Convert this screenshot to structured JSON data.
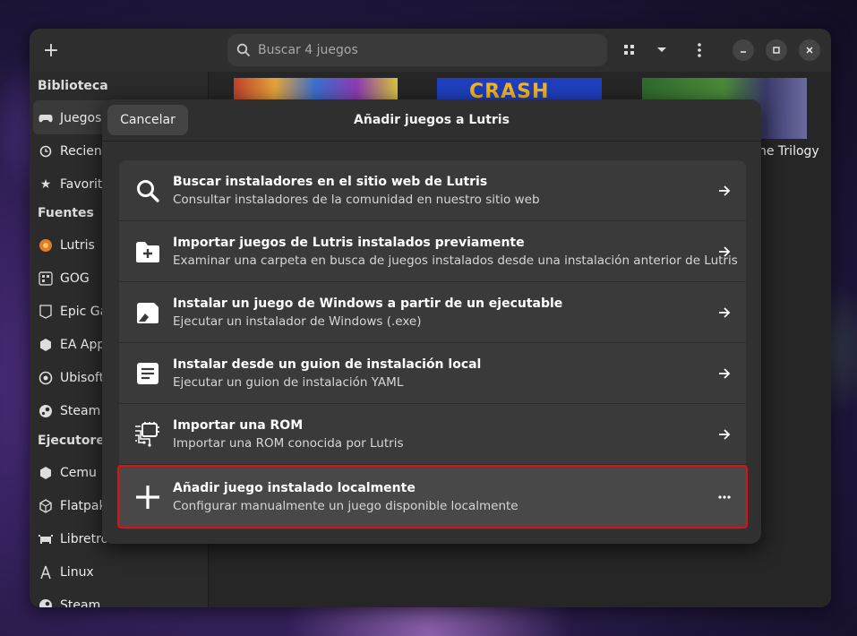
{
  "header": {
    "add_label": "+",
    "search_placeholder": "Buscar 4 juegos"
  },
  "sidebar": {
    "sections": [
      {
        "label": "Biblioteca"
      },
      {
        "label": "Fuentes"
      },
      {
        "label": "Ejecutores"
      }
    ],
    "items": [
      {
        "label": "Juegos",
        "icon": "gamepad-icon"
      },
      {
        "label": "Recient",
        "icon": "clock-icon"
      },
      {
        "label": "Favorit",
        "icon": "star-icon"
      },
      {
        "label": "Lutris",
        "icon": "lutris-icon"
      },
      {
        "label": "GOG",
        "icon": "gog-icon"
      },
      {
        "label": "Epic Ga",
        "icon": "epic-icon"
      },
      {
        "label": "EA App",
        "icon": "ea-icon"
      },
      {
        "label": "Ubisoft",
        "icon": "ubisoft-icon"
      },
      {
        "label": "Steam",
        "icon": "steam-icon"
      },
      {
        "label": "Cemu",
        "icon": "cemu-icon"
      },
      {
        "label": "Flatpak",
        "icon": "flatpak-icon"
      },
      {
        "label": "Libretro",
        "icon": "libretro-icon"
      },
      {
        "label": "Linux",
        "icon": "linux-icon"
      },
      {
        "label": "Steam",
        "icon": "steam-icon"
      }
    ]
  },
  "content": {
    "game_label_partial": "ne Trilogy",
    "thumb_text": "CRASH"
  },
  "dialog": {
    "title": "Añadir juegos a Lutris",
    "cancel_label": "Cancelar",
    "options": [
      {
        "title": "Buscar instaladores en el sitio web de Lutris",
        "subtitle": "Consultar instaladores de la comunidad en nuestro sitio web",
        "icon": "search-icon",
        "action": "arrow-right-icon"
      },
      {
        "title": "Importar juegos de Lutris instalados previamente",
        "subtitle": "Examinar una carpeta en busca de juegos instalados desde una instalación anterior de Lutris",
        "icon": "folder-add-icon",
        "action": "arrow-right-icon"
      },
      {
        "title": "Instalar un juego de Windows a partir de un ejecutable",
        "subtitle": "Ejecutar un instalador de Windows (.exe)",
        "icon": "windows-executable-icon",
        "action": "arrow-right-icon"
      },
      {
        "title": "Instalar desde un guion de instalación local",
        "subtitle": "Ejecutar un guion de instalación YAML",
        "icon": "script-document-icon",
        "action": "arrow-right-icon"
      },
      {
        "title": "Importar una ROM",
        "subtitle": "Importar una ROM conocida por Lutris",
        "icon": "rom-chip-icon",
        "action": "arrow-right-icon"
      },
      {
        "title": "Añadir juego instalado localmente",
        "subtitle": "Configurar manualmente un juego disponible localmente",
        "icon": "plus-icon",
        "action": "ellipsis-icon"
      }
    ]
  },
  "colors": {
    "highlight_border": "#e01010",
    "window_bg": "#242424",
    "dialog_bg": "#303030"
  }
}
